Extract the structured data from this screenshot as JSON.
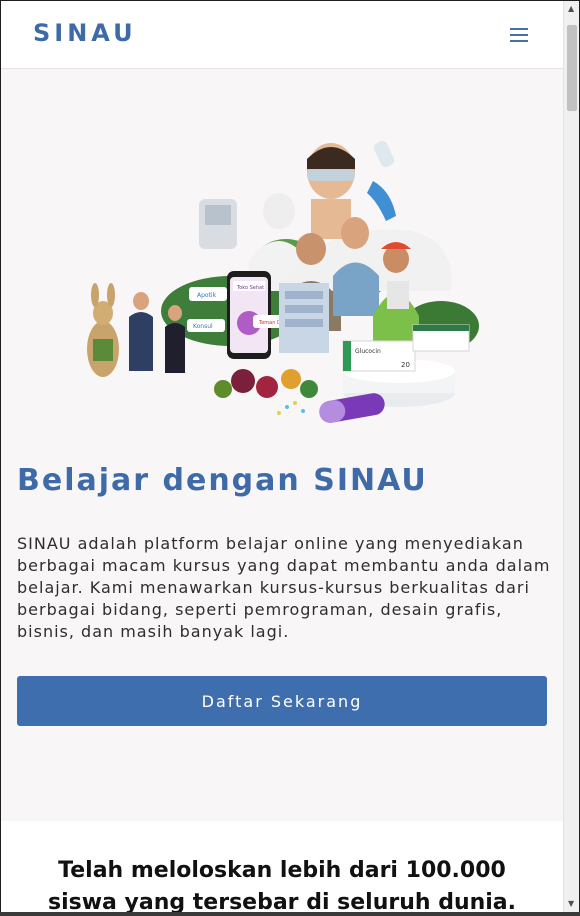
{
  "navbar": {
    "brand": "SINAU",
    "menu_icon": "hamburger-menu-icon"
  },
  "hero": {
    "title": "Belajar dengan SINAU",
    "description": "SINAU adalah platform belajar online yang menyediakan berbagai macam kursus yang dapat membantu anda dalam belajar. Kami menawarkan kursus-kursus berkualitas dari berbagai bidang, seperti pemrograman, desain grafis, bisnis, dan masih banyak lagi.",
    "cta_label": "Daftar Sekarang",
    "illustration": {
      "phone_texts": [
        "Apotik",
        "Konsul",
        "Toko Sehat",
        "Teman Diabetes"
      ],
      "box_text": "Glucocin",
      "box_number": "20"
    }
  },
  "stats": {
    "title": "Telah meloloskan lebih dari 100.000 siswa yang tersebar di seluruh dunia."
  },
  "colors": {
    "brand": "#3f6aa8",
    "button": "#3f6eaf",
    "hero_bg": "#f8f6f7",
    "text": "#2e2e2e"
  }
}
